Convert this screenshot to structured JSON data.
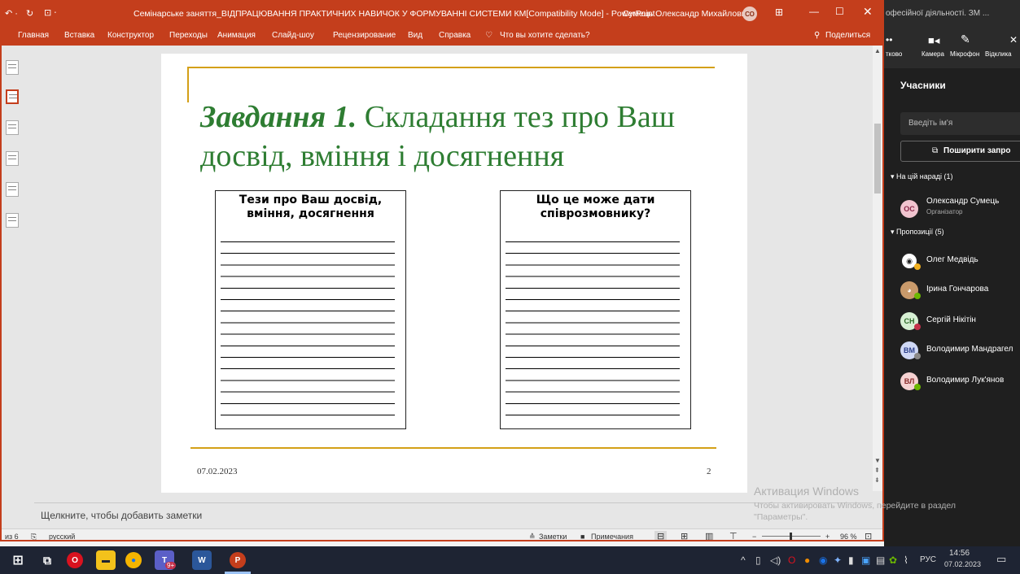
{
  "ppt": {
    "title": "Семінарське заняття_ВІДПРАЦЮВАННЯ ПРАКТИЧНИХ НАВИЧОК У ФОРМУВАННІ СИСТЕМИ КМ[Compatibility Mode]  -  PowerPoint",
    "user": "Сумець Олександр Михайлович",
    "user_initials": "СО",
    "menu": [
      "Главная",
      "Вставка",
      "Конструктор",
      "Переходы",
      "Анимация",
      "Слайд-шоу",
      "Рецензирование",
      "Вид",
      "Справка"
    ],
    "tell_me": "Что вы хотите сделать?",
    "share": "Поделиться",
    "slide": {
      "title_bold": "Завдання 1.",
      "title_rest": " Складання тез про Ваш досвід, вміння і досягнення",
      "box1": "Тези про Ваш досвід, вміння, досягнення",
      "box2": "Що це може дати співрозмовнику?",
      "date": "07.02.2023",
      "page": "2"
    },
    "notes_placeholder": "Щелкните, чтобы добавить заметки",
    "status": {
      "slide_of": "из 6",
      "language": "русский",
      "notes": "Заметки",
      "comments": "Примечания",
      "zoom": "96 %"
    }
  },
  "teams": {
    "window_title": "офесійної діяльності. ЗМ ...",
    "controls": {
      "more": "тково",
      "camera": "Камера",
      "mic": "Мікрофон",
      "leave": "Відклика"
    },
    "panel_title": "Учасники",
    "search_placeholder": "Введіть ім'я",
    "share_button": "Поширити запро",
    "in_meeting": "На цій нараді (1)",
    "suggestions": "Пропозиції (5)",
    "organizer": {
      "initials": "ОС",
      "name": "Олександр Сумець",
      "role": "Організатор"
    },
    "people": [
      {
        "initials": "",
        "name": "Олег Медвідь"
      },
      {
        "initials": "",
        "name": "Ірина Гончарова"
      },
      {
        "initials": "СН",
        "name": "Сергій Нікітін"
      },
      {
        "initials": "ВМ",
        "name": "Володимир Мандрагел"
      },
      {
        "initials": "ВЛ",
        "name": "Володимир Лук'янов"
      }
    ]
  },
  "activation": {
    "title": "Активация Windows",
    "subtitle": "Чтобы активировать Windows, перейдите в раздел \"Параметры\"."
  },
  "taskbar": {
    "lang": "РУС",
    "time": "14:56",
    "date": "07.02.2023",
    "teams_badge": "9+"
  },
  "colors": {
    "ppt_accent": "#c43e1c",
    "slide_green": "#2e7d32",
    "gold_line": "#d4a017",
    "teams_bg": "#1f1f1f"
  }
}
